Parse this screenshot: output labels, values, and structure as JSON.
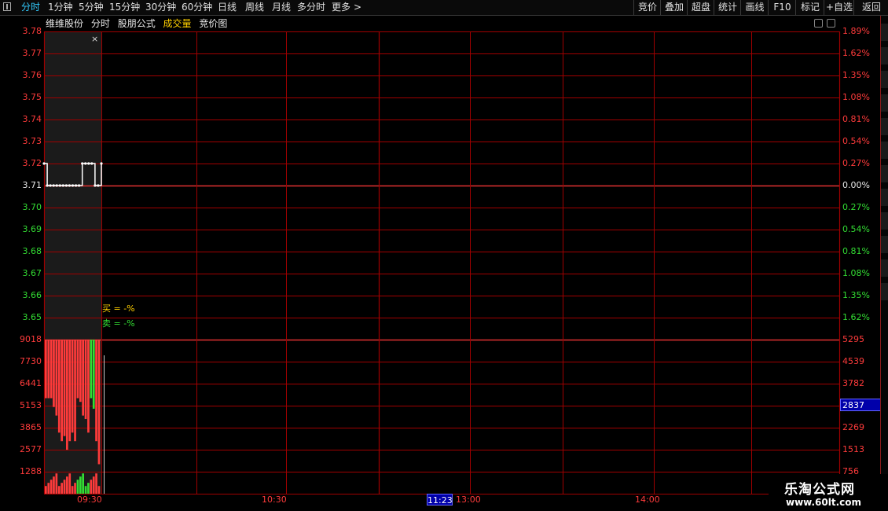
{
  "toolbar": {
    "left_items": [
      "分时",
      "1分钟",
      "5分钟",
      "15分钟",
      "30分钟",
      "60分钟",
      "日线",
      "周线",
      "月线",
      "多分时",
      "更多"
    ],
    "more_arrow": ">",
    "right_items": [
      "竞价",
      "叠加",
      "超盘",
      "统计",
      "画线",
      "F10",
      "标记",
      "+自选",
      "返回"
    ]
  },
  "title": {
    "stock_name": "维维股份",
    "chart_mode": "分时",
    "formula": "股朋公式",
    "volume": "成交量",
    "auction": "竞价图"
  },
  "close_mark": "×",
  "price_axis": {
    "left": [
      "3.78",
      "3.77",
      "3.76",
      "3.75",
      "3.74",
      "3.73",
      "3.72",
      "3.71",
      "3.70",
      "3.69",
      "3.68",
      "3.67",
      "3.66",
      "3.65"
    ],
    "right": [
      "1.89%",
      "1.62%",
      "1.35%",
      "1.08%",
      "0.81%",
      "0.54%",
      "0.27%",
      "0.00%",
      "0.27%",
      "0.54%",
      "0.81%",
      "1.08%",
      "1.35%",
      "1.62%"
    ]
  },
  "volume_axis": {
    "left": [
      "9018",
      "7730",
      "6441",
      "5153",
      "3865",
      "2577",
      "1288"
    ],
    "right": [
      "5295",
      "4539",
      "3782",
      "2837",
      "2269",
      "1513",
      "756"
    ]
  },
  "legend": {
    "buy": "买 = -%",
    "sell": "卖 = -%"
  },
  "time_axis": {
    "labels": [
      "09:30",
      "10:30",
      "13:00",
      "14:00"
    ],
    "cursor_time": "11:23"
  },
  "watermark": {
    "line1": "乐淘公式网",
    "line2": "www.60lt.com"
  },
  "colors": {
    "grid": "#a00000",
    "up": "#ff3b3b",
    "down": "#33dd33",
    "price_line": "#ffffff",
    "accent": "#33ccff"
  },
  "chart_data": {
    "type": "line",
    "price_line": {
      "y_range": [
        3.65,
        3.78
      ],
      "base_price": 3.71,
      "values": [
        3.72,
        3.71,
        3.71,
        3.71,
        3.71,
        3.71,
        3.71,
        3.71,
        3.71,
        3.71,
        3.71,
        3.71,
        3.72,
        3.72,
        3.72,
        3.72,
        3.71,
        3.71,
        3.72
      ]
    },
    "volume_bars": {
      "y_range": [
        0,
        9018
      ],
      "values": [
        9018,
        9018,
        9018,
        8500,
        8000,
        7000,
        6500,
        6800,
        6000,
        6500,
        7000,
        6500,
        9018,
        8800,
        8000,
        7800,
        7000,
        9018,
        8400,
        6500,
        5153
      ],
      "colors": [
        "red",
        "red",
        "red",
        "red",
        "red",
        "red",
        "red",
        "red",
        "red",
        "red",
        "red",
        "red",
        "red",
        "red",
        "red",
        "red",
        "red",
        "green",
        "green",
        "red",
        "red"
      ]
    }
  }
}
